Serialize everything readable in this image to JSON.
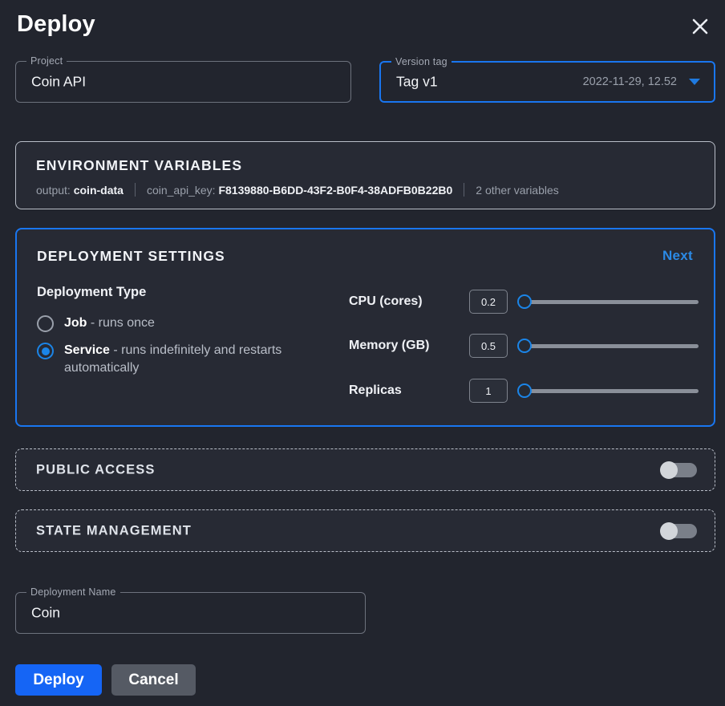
{
  "dialog": {
    "title": "Deploy",
    "close_icon": "close-icon"
  },
  "fields": {
    "project": {
      "label": "Project",
      "value": "Coin API"
    },
    "version_tag": {
      "label": "Version tag",
      "value": "Tag v1",
      "meta": "2022-11-29, 12.52",
      "caret_icon": "chevron-down-icon",
      "focused": true
    },
    "deployment_name": {
      "label": "Deployment Name",
      "value": "Coin"
    }
  },
  "environment_variables": {
    "title": "ENVIRONMENT VARIABLES",
    "items": [
      {
        "key": "output:",
        "value": "coin-data"
      },
      {
        "key": "coin_api_key:",
        "value": "F8139880-B6DD-43F2-B0F4-38ADFB0B22B0"
      }
    ],
    "more": "2 other variables"
  },
  "deployment_settings": {
    "title": "DEPLOYMENT SETTINGS",
    "next_label": "Next",
    "deployment_type_label": "Deployment Type",
    "options": [
      {
        "name": "Job",
        "description": " - runs once",
        "selected": false
      },
      {
        "name": "Service",
        "description": " - runs indefinitely and restarts automatically",
        "selected": true
      }
    ],
    "sliders": [
      {
        "label": "CPU (cores)",
        "value": "0.2",
        "position_pct": 0
      },
      {
        "label": "Memory (GB)",
        "value": "0.5",
        "position_pct": 0
      },
      {
        "label": "Replicas",
        "value": "1",
        "position_pct": 0
      }
    ]
  },
  "public_access": {
    "title": "PUBLIC ACCESS",
    "enabled": false
  },
  "state_management": {
    "title": "STATE MANAGEMENT",
    "enabled": false
  },
  "actions": {
    "deploy_label": "Deploy",
    "cancel_label": "Cancel"
  },
  "colors": {
    "background": "#22252e",
    "panel": "#272a34",
    "accent": "#1976f0",
    "primary_button": "#1565f5",
    "secondary_button": "#555a64",
    "link": "#2b8ae6",
    "muted_text": "#9aa0ab"
  }
}
